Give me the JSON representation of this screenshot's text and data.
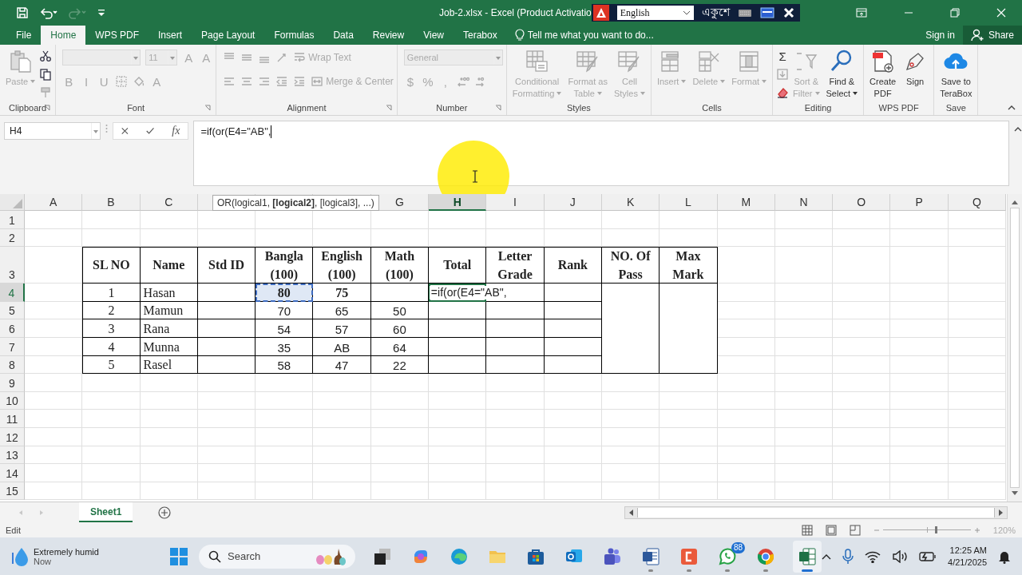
{
  "title_bar": {
    "document_title": "Job-2.xlsx - Excel (Product Activatio",
    "ime": {
      "language": "English",
      "script_label": "একুশে"
    }
  },
  "menu_tabs": [
    {
      "label": "File",
      "selected": false
    },
    {
      "label": "Home",
      "selected": true
    },
    {
      "label": "WPS PDF",
      "selected": false
    },
    {
      "label": "Insert",
      "selected": false
    },
    {
      "label": "Page Layout",
      "selected": false
    },
    {
      "label": "Formulas",
      "selected": false
    },
    {
      "label": "Data",
      "selected": false
    },
    {
      "label": "Review",
      "selected": false
    },
    {
      "label": "View",
      "selected": false
    },
    {
      "label": "Terabox",
      "selected": false
    }
  ],
  "tell_me": {
    "placeholder": "Tell me what you want to do..."
  },
  "account": {
    "sign_in": "Sign in",
    "share": "Share"
  },
  "ribbon": {
    "groups": [
      {
        "label": "Clipboard",
        "launcher": true,
        "parts": [
          {
            "kind": "large",
            "label": "Paste",
            "disabled": true,
            "menu": true
          },
          {
            "kind": "stack",
            "rows": [
              [
                {
                  "kind": "icon",
                  "disabled": false
                }
              ],
              [
                {
                  "kind": "icon",
                  "disabled": false
                }
              ],
              [
                {
                  "kind": "icon",
                  "disabled": true
                }
              ]
            ]
          }
        ]
      },
      {
        "label": "Font",
        "launcher": true,
        "parts": [
          {
            "kind": "stack",
            "rows": [
              [
                {
                  "kind": "field",
                  "disabled": true
                },
                {
                  "kind": "field",
                  "value": "11",
                  "disabled": true
                },
                {
                  "kind": "glyph",
                  "label": "A",
                  "disabled": true
                },
                {
                  "kind": "glyph",
                  "label": "A",
                  "disabled": true
                }
              ],
              [
                {
                  "kind": "glyph",
                  "label": "B",
                  "disabled": true
                },
                {
                  "kind": "glyph",
                  "label": "I",
                  "disabled": true
                },
                {
                  "kind": "glyph",
                  "label": "U",
                  "disabled": true
                },
                {
                  "kind": "icon",
                  "disabled": true
                },
                {
                  "kind": "icon",
                  "disabled": true
                },
                {
                  "kind": "glyph",
                  "label": "A",
                  "disabled": true
                }
              ]
            ]
          }
        ]
      },
      {
        "label": "Alignment",
        "launcher": true,
        "parts": [
          {
            "kind": "stack",
            "rows": [
              [
                {
                  "kind": "icon",
                  "disabled": true
                },
                {
                  "kind": "icon",
                  "disabled": true
                },
                {
                  "kind": "icon",
                  "disabled": true
                },
                {
                  "kind": "icon",
                  "disabled": true
                },
                {
                  "kind": "text-button",
                  "label": "Wrap Text",
                  "disabled": true
                }
              ],
              [
                {
                  "kind": "icon",
                  "disabled": true
                },
                {
                  "kind": "icon",
                  "disabled": true
                },
                {
                  "kind": "icon",
                  "disabled": true
                },
                {
                  "kind": "icon",
                  "disabled": true
                },
                {
                  "kind": "icon",
                  "disabled": true
                },
                {
                  "kind": "text-button",
                  "label": "Merge & Center",
                  "disabled": true
                }
              ]
            ]
          }
        ]
      },
      {
        "label": "Number",
        "launcher": true,
        "parts": [
          {
            "kind": "stack",
            "rows": [
              [
                {
                  "kind": "field",
                  "value": "General",
                  "disabled": true
                }
              ],
              [
                {
                  "kind": "glyph",
                  "label": "$",
                  "disabled": true
                },
                {
                  "kind": "glyph",
                  "label": "%",
                  "disabled": true
                },
                {
                  "kind": "glyph",
                  "label": ",",
                  "disabled": true
                },
                {
                  "kind": "icon",
                  "disabled": true
                },
                {
                  "kind": "icon",
                  "disabled": true
                }
              ]
            ]
          }
        ]
      },
      {
        "label": "Styles",
        "launcher": false,
        "parts": [
          {
            "kind": "large",
            "label": "Conditional\nFormatting",
            "disabled": true,
            "menu": true
          },
          {
            "kind": "large",
            "label": "Format as\nTable",
            "disabled": true,
            "menu": true
          },
          {
            "kind": "large",
            "label": "Cell\nStyles",
            "disabled": true,
            "menu": true
          }
        ]
      },
      {
        "label": "Cells",
        "launcher": false,
        "parts": [
          {
            "kind": "large",
            "label": "Insert",
            "disabled": true,
            "menu": true
          },
          {
            "kind": "large",
            "label": "Delete",
            "disabled": true,
            "menu": true
          },
          {
            "kind": "large",
            "label": "Format",
            "disabled": true,
            "menu": true
          }
        ]
      },
      {
        "label": "Editing",
        "launcher": false,
        "parts": [
          {
            "kind": "stack",
            "rows": [
              [
                {
                  "kind": "glyph",
                  "label": "Σ",
                  "disabled": false
                }
              ],
              [
                {
                  "kind": "icon",
                  "disabled": true
                }
              ],
              [
                {
                  "kind": "icon",
                  "disabled": false
                }
              ]
            ]
          },
          {
            "kind": "large",
            "label": "Sort &\nFilter",
            "disabled": true,
            "menu": true
          },
          {
            "kind": "large",
            "label": "Find &\nSelect",
            "disabled": false,
            "menu": true
          }
        ]
      },
      {
        "label": "WPS PDF",
        "launcher": false,
        "parts": [
          {
            "kind": "large",
            "label": "Create\nPDF",
            "disabled": false,
            "menu": false
          },
          {
            "kind": "large",
            "label": "Sign",
            "disabled": false,
            "menu": false
          }
        ]
      },
      {
        "label": "Save",
        "launcher": false,
        "parts": [
          {
            "kind": "large",
            "label": "Save to\nTeraBox",
            "disabled": false,
            "menu": false
          }
        ]
      }
    ]
  },
  "formula_bar": {
    "name_box": "H4",
    "fx": "fx",
    "formula": "=if(or(E4=\"AB\","
  },
  "function_tooltip": "OR(logical1, **[logical2]**, [logical3], ...)",
  "sheet": {
    "columns": [
      {
        "label": "A",
        "selected": false
      },
      {
        "label": "B",
        "selected": false
      },
      {
        "label": "C",
        "selected": false
      },
      {
        "selected": false
      },
      {
        "selected": false
      },
      {
        "selected": false
      },
      {
        "label": "G",
        "selected": false
      },
      {
        "label": "H",
        "selected": true
      },
      {
        "label": "I",
        "selected": false
      },
      {
        "label": "J",
        "selected": false
      },
      {
        "label": "K",
        "selected": false
      },
      {
        "label": "L",
        "selected": false
      },
      {
        "label": "M",
        "selected": false
      },
      {
        "label": "N",
        "selected": false
      },
      {
        "label": "O",
        "selected": false
      },
      {
        "label": "P",
        "selected": false
      },
      {
        "label": "Q",
        "selected": false
      }
    ],
    "rows": [
      {
        "label": "1",
        "selected": false
      },
      {
        "label": "2",
        "selected": false
      },
      {
        "label": "3",
        "selected": false
      },
      {
        "label": "4",
        "selected": true
      },
      {
        "label": "5",
        "selected": false
      },
      {
        "label": "6",
        "selected": false
      },
      {
        "label": "7",
        "selected": false
      },
      {
        "label": "8",
        "selected": false
      },
      {
        "label": "9",
        "selected": false
      },
      {
        "label": "10",
        "selected": false
      },
      {
        "label": "11",
        "selected": false
      },
      {
        "label": "12",
        "selected": false
      },
      {
        "label": "13",
        "selected": false
      },
      {
        "label": "14",
        "selected": false
      },
      {
        "label": "15",
        "selected": false
      }
    ]
  },
  "table": {
    "headers": [
      "SL NO",
      "Name",
      "Std ID",
      "Bangla\n(100)",
      "English\n(100)",
      "Math\n(100)",
      "Total",
      "Letter\nGrade",
      "Rank",
      "NO. Of\nPass",
      "Max\nMark"
    ],
    "rows": [
      {
        "cells": [
          {
            "text": "1"
          },
          {
            "text": "Hasan"
          },
          {},
          {
            "text": "80",
            "bold": true,
            "referenced": true
          },
          {
            "text": "75",
            "bold": true
          },
          {},
          {
            "text": "=if(or(E4=\"AB\",",
            "editing": true
          },
          {},
          {},
          {
            "merged_down": true
          },
          {
            "merged_down": true
          }
        ]
      },
      {
        "cells": [
          {
            "text": "2"
          },
          {
            "text": "Mamun"
          },
          {},
          {
            "text": "70"
          },
          {
            "text": "65"
          },
          {
            "text": "50"
          },
          {},
          {},
          {}
        ]
      },
      {
        "cells": [
          {
            "text": "3"
          },
          {
            "text": "Rana"
          },
          {},
          {
            "text": "54"
          },
          {
            "text": "57"
          },
          {
            "text": "60"
          },
          {},
          {},
          {}
        ]
      },
      {
        "cells": [
          {
            "text": "4"
          },
          {
            "text": "Munna"
          },
          {},
          {
            "text": "35"
          },
          {
            "text": "AB"
          },
          {
            "text": "64"
          },
          {},
          {},
          {}
        ]
      },
      {
        "cells": [
          {
            "text": "5"
          },
          {
            "text": "Rasel"
          },
          {},
          {
            "text": "58"
          },
          {
            "text": "47"
          },
          {
            "text": "22"
          },
          {},
          {},
          {}
        ]
      }
    ]
  },
  "sheet_tabs": [
    {
      "label": "Sheet1",
      "selected": true
    }
  ],
  "status_bar": {
    "mode": "Edit",
    "zoom": "120%",
    "zoom_slider": {
      "level": 0.6
    }
  },
  "taskbar": {
    "weather": {
      "title": "Extremely humid",
      "subtitle": "Now"
    },
    "search": {
      "placeholder": "Search"
    },
    "apps": [
      {
        "kind": "task-view",
        "running": false,
        "active": false
      },
      {
        "kind": "knot",
        "running": false,
        "active": false
      },
      {
        "kind": "swirl",
        "running": false,
        "active": false
      },
      {
        "kind": "folder",
        "running": false,
        "active": false
      },
      {
        "kind": "store",
        "running": false,
        "active": false
      },
      {
        "kind": "mail",
        "running": false,
        "active": false
      },
      {
        "kind": "people",
        "running": false,
        "active": false
      },
      {
        "kind": "document",
        "running": true,
        "active": false
      },
      {
        "kind": "orange",
        "running": true,
        "active": false
      },
      {
        "kind": "chat",
        "running": true,
        "active": false,
        "badge": "88"
      },
      {
        "kind": "browser",
        "running": true,
        "active": false
      },
      {
        "kind": "spreadsheet",
        "running": true,
        "active": true
      }
    ],
    "clock": {
      "time": "12:25 AM",
      "date": "4/21/2025"
    }
  }
}
